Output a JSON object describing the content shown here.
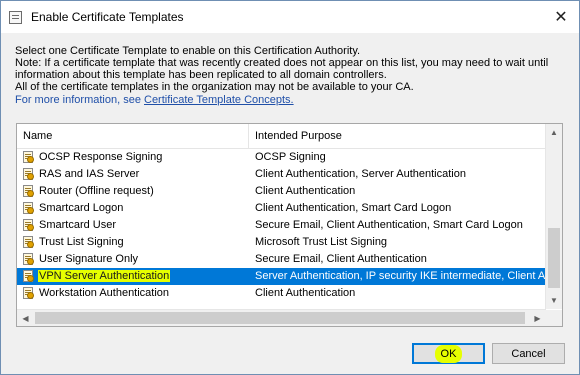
{
  "window": {
    "title": "Enable Certificate Templates",
    "close_glyph": "✕"
  },
  "info": {
    "line1": "Select one Certificate Template to enable on this Certification Authority.",
    "line2": "Note: If a certificate template that was recently created does not appear on this list, you may need to wait until",
    "line3": "information about this template has been replicated to all domain controllers.",
    "line4": "All of the certificate templates in the organization may not be available to your CA.",
    "more_prefix": "For more information, see ",
    "more_link": "Certificate Template Concepts."
  },
  "list": {
    "columns": [
      "Name",
      "Intended Purpose"
    ],
    "rows": [
      {
        "name": "OCSP Response Signing",
        "purpose": "OCSP Signing",
        "selected": false
      },
      {
        "name": "RAS and IAS Server",
        "purpose": "Client Authentication, Server Authentication",
        "selected": false
      },
      {
        "name": "Router (Offline request)",
        "purpose": "Client Authentication",
        "selected": false
      },
      {
        "name": "Smartcard Logon",
        "purpose": "Client Authentication, Smart Card Logon",
        "selected": false
      },
      {
        "name": "Smartcard User",
        "purpose": "Secure Email, Client Authentication, Smart Card Logon",
        "selected": false
      },
      {
        "name": "Trust List Signing",
        "purpose": "Microsoft Trust List Signing",
        "selected": false
      },
      {
        "name": "User Signature Only",
        "purpose": "Secure Email, Client Authentication",
        "selected": false
      },
      {
        "name": "VPN Server Authentication",
        "purpose": "Server Authentication, IP security IKE intermediate, Client Auth",
        "selected": true
      },
      {
        "name": "Workstation Authentication",
        "purpose": "Client Authentication",
        "selected": false
      }
    ]
  },
  "buttons": {
    "ok": "OK",
    "cancel": "Cancel"
  },
  "colors": {
    "selection": "#0078d7",
    "highlight": "#e6ff00",
    "link": "#1f4fa8"
  }
}
